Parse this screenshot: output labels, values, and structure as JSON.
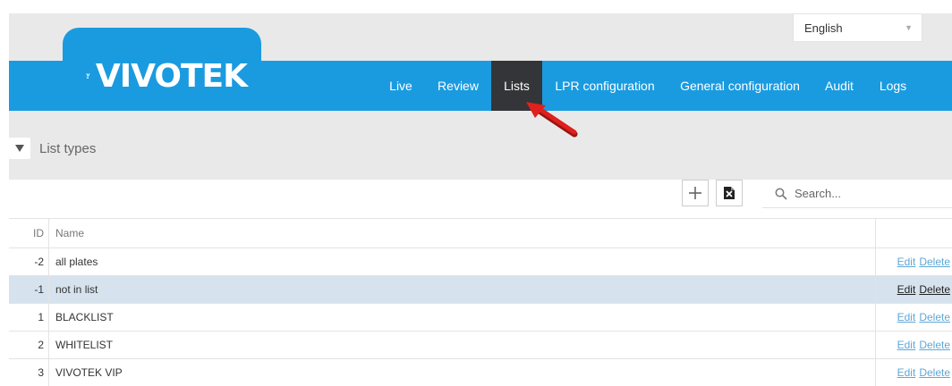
{
  "header": {
    "language": "English",
    "logo_text": "VIVOTEK"
  },
  "nav": {
    "items": [
      {
        "label": "Live"
      },
      {
        "label": "Review"
      },
      {
        "label": "Lists"
      },
      {
        "label": "LPR configuration"
      },
      {
        "label": "General configuration"
      },
      {
        "label": "Audit"
      },
      {
        "label": "Logs"
      }
    ],
    "active": "Lists"
  },
  "section": {
    "title": "List types"
  },
  "toolbar": {
    "add_icon": "plus-icon",
    "export_icon": "excel-icon",
    "search_placeholder": "Search..."
  },
  "table": {
    "columns": {
      "id": "ID",
      "name": "Name"
    },
    "rows": [
      {
        "id": "-2",
        "name": "all plates",
        "edit": "Edit",
        "delete": "Delete"
      },
      {
        "id": "-1",
        "name": "not in list",
        "edit": "Edit",
        "delete": "Delete"
      },
      {
        "id": "1",
        "name": "BLACKLIST",
        "edit": "Edit",
        "delete": "Delete"
      },
      {
        "id": "2",
        "name": "WHITELIST",
        "edit": "Edit",
        "delete": "Delete"
      },
      {
        "id": "3",
        "name": "VIVOTEK VIP",
        "edit": "Edit",
        "delete": "Delete"
      }
    ]
  },
  "colors": {
    "nav_bg": "#1a9be0",
    "nav_active": "#333538",
    "row_highlight": "#d6e3ee",
    "link": "#5fa7d6",
    "arrow": "#e0201c"
  }
}
